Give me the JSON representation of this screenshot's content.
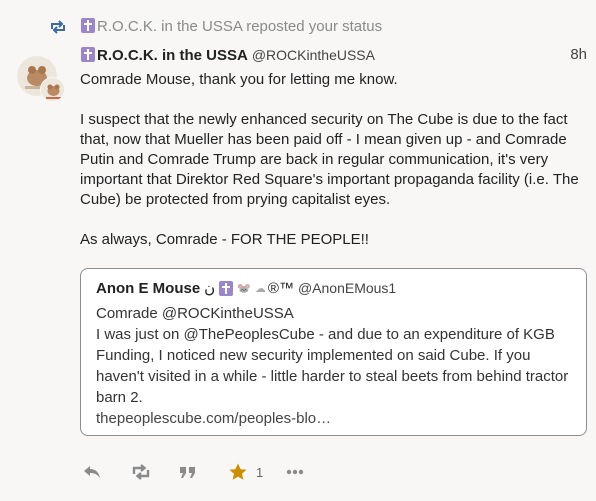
{
  "prepend": {
    "text": "R.O.C.K. in the USSA reposted your status"
  },
  "status": {
    "display_name": "R.O.C.K. in the USSA",
    "acct": "@ROCKintheUSSA",
    "timestamp": "8h",
    "paragraphs": [
      "Comrade Mouse, thank you for letting me know.",
      "I suspect that the newly enhanced security on The Cube is due to the fact that, now that Mueller has been paid off - I mean given up - and Comrade Putin and Comrade Trump are back in regular communication, it's very important that Direktor Red Square's important propaganda facility (i.e. The Cube) be protected from prying capitalist eyes.",
      "As always, Comrade - FOR THE PEOPLE!!"
    ]
  },
  "quote": {
    "display_name": "Anon E Mouse",
    "name_suffix": "ن",
    "name_emoji": "®™",
    "acct": "@AnonEMous1",
    "lines": [
      "Comrade @ROCKintheUSSA",
      "I was just on @ThePeoplesCube  - and due to an expenditure of KGB Funding, I noticed new security implemented on said Cube.  If you haven't visited in a while - little harder to steal beets from behind tractor barn 2."
    ],
    "link": "thepeoplescube.com/peoples-blo…"
  },
  "actions": {
    "favourite_count": "1",
    "colors": {
      "icon": "#8a8a8a",
      "star": "#ca8f04",
      "reblog_prepend": "#3d6aa3"
    }
  }
}
